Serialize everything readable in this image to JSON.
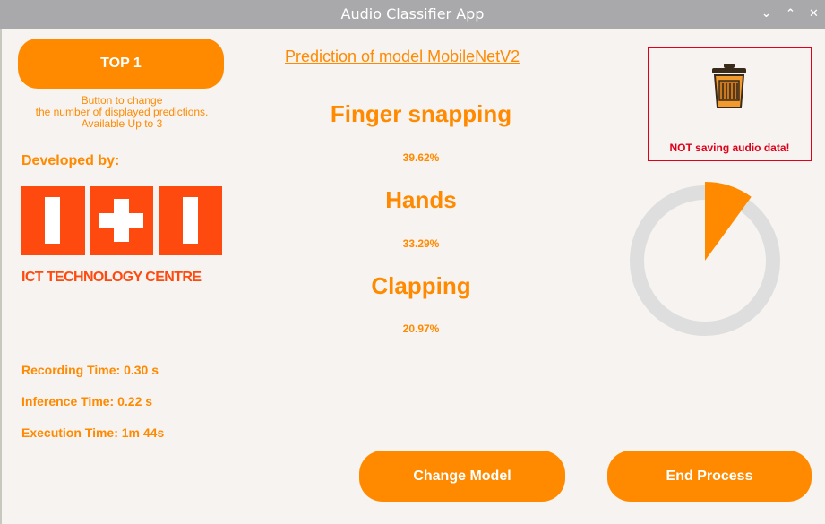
{
  "window": {
    "title": "Audio Classifier App",
    "minimize_glyph": "⌄",
    "maximize_glyph": "⌃",
    "close_glyph": "✕"
  },
  "left_panel": {
    "top_button_label": "TOP 1",
    "hint_lines": [
      "Button to change",
      "the number of displayed predictions.",
      "Available Up to 3"
    ],
    "developed_by_label": "Developed by:",
    "logo_text": "ICT TECHNOLOGY CENTRE",
    "recording_time": "Recording Time: 0.30 s",
    "inference_time": "Inference Time: 0.22 s",
    "execution_time": "Execution Time: 1m 44s"
  },
  "predictions": {
    "title": "Prediction of model MobileNetV2",
    "items": [
      {
        "label": "Finger snapping",
        "percent": "39.62%"
      },
      {
        "label": "Hands",
        "percent": "33.29%"
      },
      {
        "label": "Clapping",
        "percent": "20.97%"
      }
    ]
  },
  "audio_saving": {
    "status_text": "NOT saving audio data!",
    "icon": "trash-icon"
  },
  "progress_gauge": {
    "fraction": 0.1
  },
  "buttons": {
    "change_model": "Change Model",
    "end_process": "End Process"
  },
  "colors": {
    "accent": "#ff8a00",
    "logo_red": "#ff4a0f",
    "warning_red": "#e0001a",
    "titlebar": "#a9a9ab",
    "background": "#f6f3f1"
  }
}
